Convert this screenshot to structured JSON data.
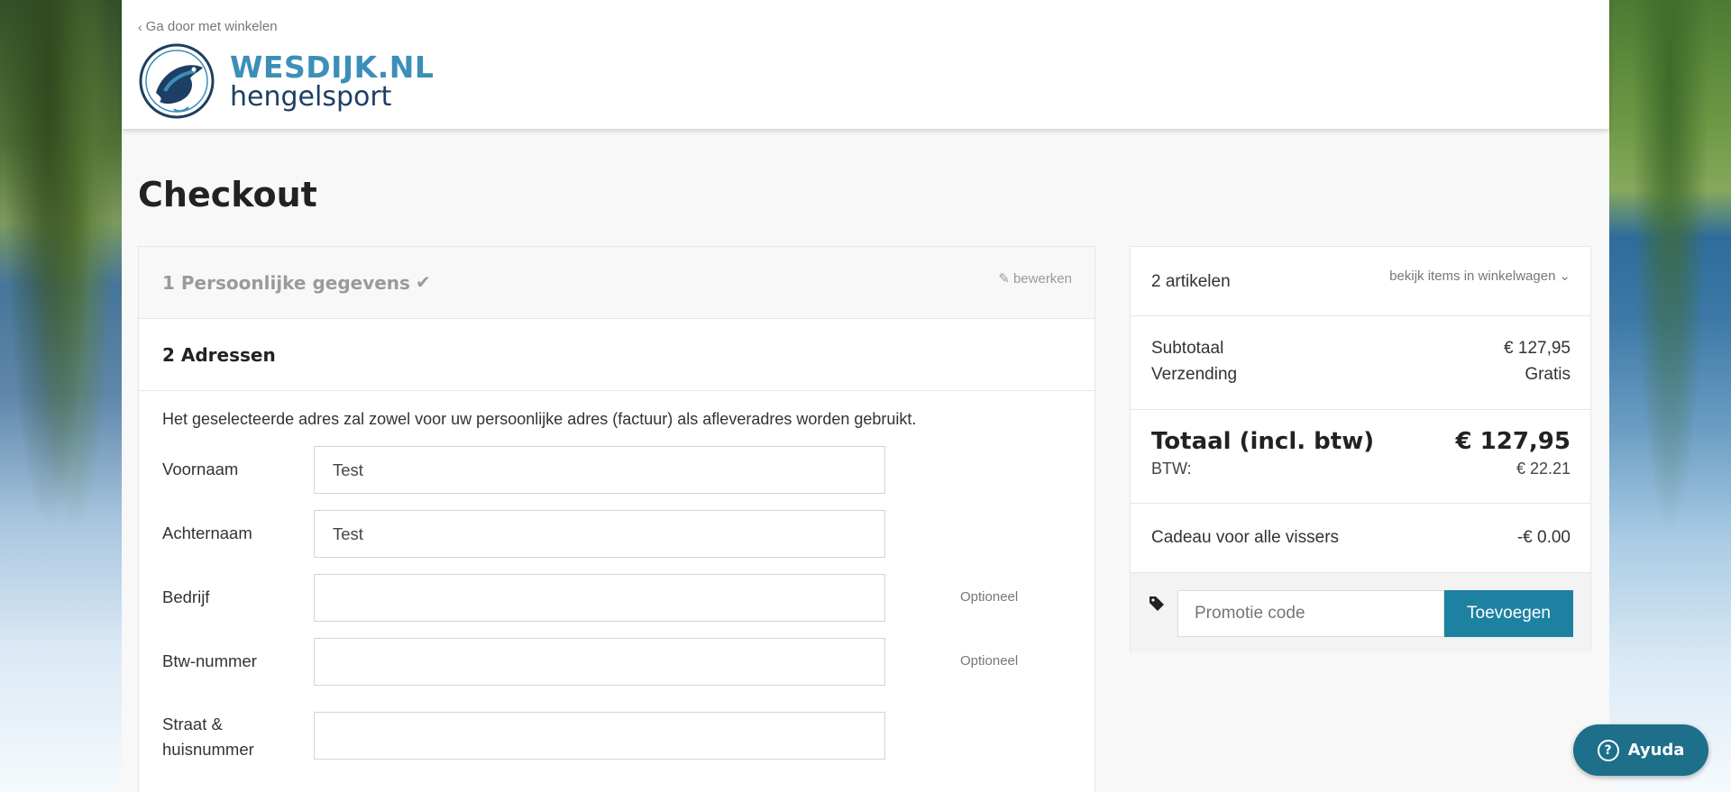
{
  "header": {
    "back_link": "Ga door met winkelen",
    "logo_title": "WESDIJK.NL",
    "logo_sub": "hengelsport"
  },
  "page_title": "Checkout",
  "steps": [
    {
      "label": "1 Persoonlijke gegevens",
      "edit_label": "bewerken"
    },
    {
      "label": "2 Adressen"
    }
  ],
  "address_note": "Het geselecteerde adres zal zowel voor uw persoonlijke adres (factuur) als afleveradres worden gebruikt.",
  "form": {
    "fields": [
      {
        "label": "Voornaam",
        "value": "Test",
        "optional": ""
      },
      {
        "label": "Achternaam",
        "value": "Test",
        "optional": ""
      },
      {
        "label": "Bedrijf",
        "value": "",
        "optional": "Optioneel"
      },
      {
        "label": "Btw-nummer",
        "value": "",
        "optional": "Optioneel"
      },
      {
        "label": "Straat & huisnummer",
        "value": "",
        "optional": ""
      }
    ]
  },
  "summary": {
    "items_count": "2 artikelen",
    "view_items": "bekijk items in winkelwagen",
    "subtotal_label": "Subtotaal",
    "subtotal_value": "€ 127,95",
    "shipping_label": "Verzending",
    "shipping_value": "Gratis",
    "total_label": "Totaal (incl. btw)",
    "total_value": "€ 127,95",
    "btw_label": "BTW:",
    "btw_value": "€ 22.21",
    "gift_label": "Cadeau voor alle vissers",
    "gift_value": "-€ 0.00",
    "promo_placeholder": "Promotie code",
    "promo_button": "Toevoegen"
  },
  "help": {
    "label": "Ayuda"
  },
  "colors": {
    "accent": "#1d81a2",
    "logo_blue": "#3b8fb8",
    "logo_navy": "#1d3f63"
  }
}
